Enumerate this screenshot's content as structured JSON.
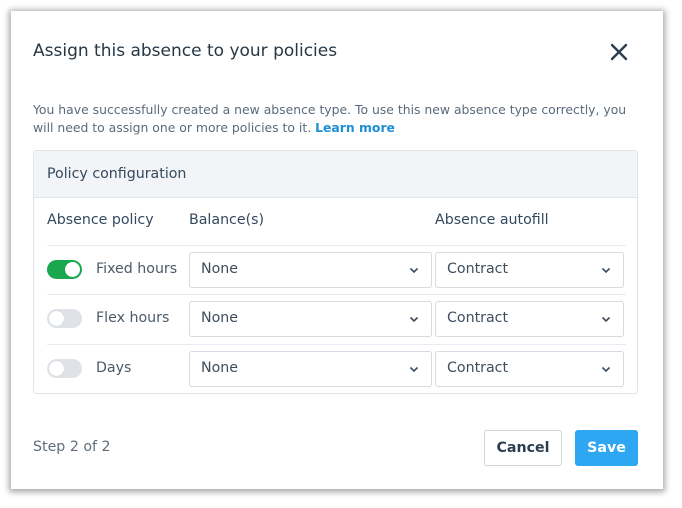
{
  "dialog": {
    "title": "Assign this absence to your policies",
    "description": "You have successfully created a new absence type. To use this new absence type correctly, you will need to assign one or more policies to it.",
    "learn_more": "Learn more"
  },
  "panel": {
    "title": "Policy configuration",
    "columns": {
      "policy": "Absence policy",
      "balance": "Balance(s)",
      "autofill": "Absence autofill"
    },
    "rows": [
      {
        "enabled": true,
        "name": "Fixed hours",
        "balance": "None",
        "autofill": "Contract"
      },
      {
        "enabled": false,
        "name": "Flex hours",
        "balance": "None",
        "autofill": "Contract"
      },
      {
        "enabled": false,
        "name": "Days",
        "balance": "None",
        "autofill": "Contract"
      }
    ]
  },
  "footer": {
    "step": "Step 2 of 2",
    "cancel": "Cancel",
    "save": "Save"
  },
  "colors": {
    "toggle_on": "#19a84e",
    "toggle_off": "#dfe3e8",
    "primary": "#2ea6f2",
    "link": "#1e8fd6"
  },
  "icons": {
    "close": "close-icon",
    "dropdown": "chevron-down-icon"
  }
}
